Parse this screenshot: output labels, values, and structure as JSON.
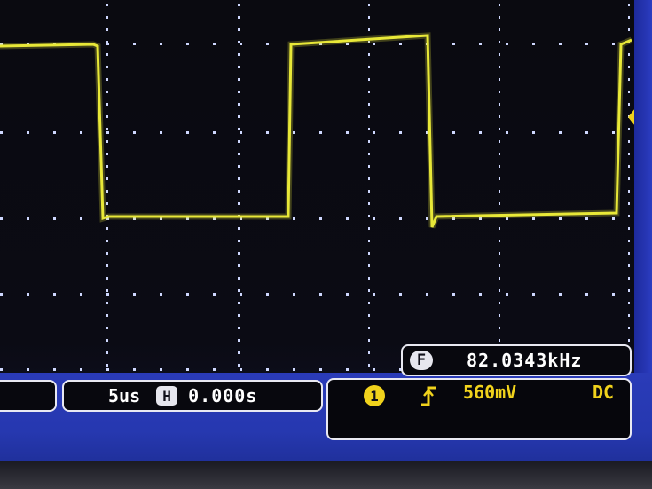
{
  "colors": {
    "trace": "#e8e838",
    "grid_dot": "#cfd8ff",
    "panel_blue": "#2a3bb8",
    "trigger_yellow": "#f0d21c"
  },
  "measurement": {
    "badge": "F",
    "frequency": "82.0343kHz"
  },
  "timebase": {
    "scale": "5us",
    "badge": "H",
    "position": "0.000s"
  },
  "trigger": {
    "channel_badge": "1",
    "edge_icon": "rising-edge-icon",
    "level": "560mV",
    "coupling": "DC"
  },
  "icons": {
    "trigger_marker": "trigger-level-arrow-icon"
  }
}
